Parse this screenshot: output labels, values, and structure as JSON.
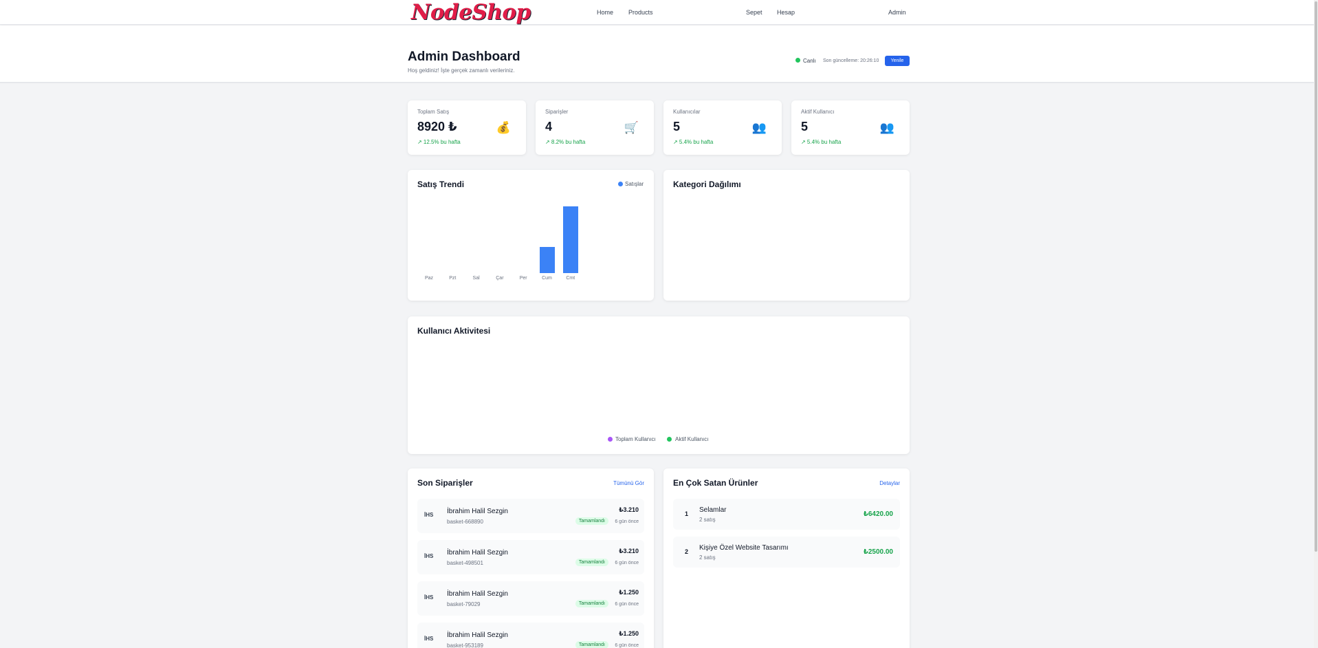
{
  "nav": {
    "logo": "NodeShop",
    "home": "Home",
    "products": "Products",
    "cart": "Sepet",
    "account": "Hesap",
    "admin": "Admin"
  },
  "header": {
    "title": "Admin Dashboard",
    "subtitle": "Hoş geldiniz! İşte gerçek zamanlı verileriniz.",
    "live": "Canlı",
    "last_update": "Son güncelleme: 20:26:10",
    "refresh": "Yenile"
  },
  "stats": [
    {
      "label": "Toplam Satış",
      "value": "8920 ₺",
      "trend": "↗ 12.5% bu hafta",
      "icon": "money-bag-icon"
    },
    {
      "label": "Siparişler",
      "value": "4",
      "trend": "↗ 8.2% bu hafta",
      "icon": "cart-icon"
    },
    {
      "label": "Kullanıcılar",
      "value": "5",
      "trend": "↗ 5.4% bu hafta",
      "icon": "users-icon"
    },
    {
      "label": "Aktif Kullanıcı",
      "value": "5",
      "trend": "↗ 5.4% bu hafta",
      "icon": "users-icon"
    }
  ],
  "sales_trend": {
    "title": "Satış Trendi",
    "legend": "Satışlar"
  },
  "chart_data": {
    "type": "bar",
    "categories": [
      "Paz",
      "Pzt",
      "Sal",
      "Çar",
      "Per",
      "Cum",
      "Cmt"
    ],
    "series": [
      {
        "name": "Satışlar",
        "values": [
          0,
          0,
          0,
          0,
          0,
          2500,
          6420
        ]
      }
    ],
    "color": "#3b82f6",
    "ylim": [
      0,
      6420
    ]
  },
  "category_dist": {
    "title": "Kategori Dağılımı"
  },
  "user_activity": {
    "title": "Kullanıcı Aktivitesi",
    "legend_total": "Toplam Kullanıcı",
    "legend_active": "Aktif Kullanıcı",
    "total_color": "#a855f7",
    "active_color": "#22c55e"
  },
  "recent_orders": {
    "title": "Son Siparişler",
    "link": "Tümünü Gör",
    "items": [
      {
        "avatar": "İHS",
        "name": "İbrahim Halil Sezgin",
        "basket": "basket-668890",
        "amount": "₺3.210",
        "status": "Tamamlandı",
        "time": "6 gün önce"
      },
      {
        "avatar": "İHS",
        "name": "İbrahim Halil Sezgin",
        "basket": "basket-498501",
        "amount": "₺3.210",
        "status": "Tamamlandı",
        "time": "6 gün önce"
      },
      {
        "avatar": "İHS",
        "name": "İbrahim Halil Sezgin",
        "basket": "basket-79029",
        "amount": "₺1.250",
        "status": "Tamamlandı",
        "time": "6 gün önce"
      },
      {
        "avatar": "İHS",
        "name": "İbrahim Halil Sezgin",
        "basket": "basket-953189",
        "amount": "₺1.250",
        "status": "Tamamlandı",
        "time": "6 gün önce"
      }
    ]
  },
  "top_products": {
    "title": "En Çok Satan Ürünler",
    "link": "Detaylar",
    "items": [
      {
        "rank": "1",
        "name": "Selamlar",
        "sales": "2 satış",
        "revenue": "₺6420.00"
      },
      {
        "rank": "2",
        "name": "Kişiye Özel Website Tasarımı",
        "sales": "2 satış",
        "revenue": "₺2500.00"
      }
    ]
  }
}
